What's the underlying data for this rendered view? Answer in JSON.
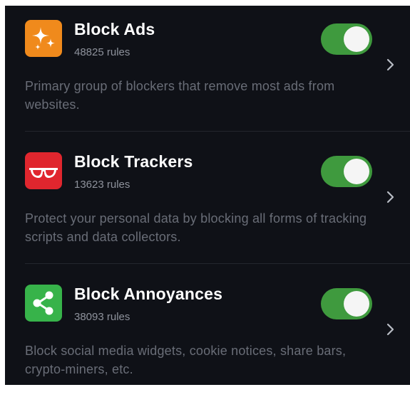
{
  "blockers": [
    {
      "title": "Block Ads",
      "rules": "48825 rules",
      "description": "Primary group of blockers that remove most ads from websites.",
      "enabled": true,
      "icon": "sparkles-icon",
      "icon_color": "#f08a1c"
    },
    {
      "title": "Block Trackers",
      "rules": "13623 rules",
      "description": "Protect your personal data by blocking all forms of tracking scripts and data collectors.",
      "enabled": true,
      "icon": "sunglasses-icon",
      "icon_color": "#e0262e"
    },
    {
      "title": "Block Annoyances",
      "rules": "38093 rules",
      "description": "Block social media widgets, cookie notices, share bars, crypto-miners, etc.",
      "enabled": true,
      "icon": "share-icon",
      "icon_color": "#37b34a"
    }
  ],
  "colors": {
    "background": "#0f1117",
    "toggle_on": "#3f9a3e",
    "secondary_text": "#8e929c",
    "description_text": "#696d77"
  }
}
